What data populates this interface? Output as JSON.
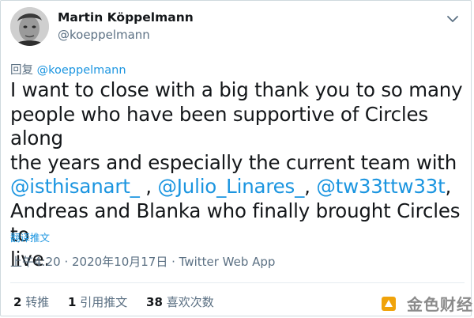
{
  "author": {
    "display_name": "Martin Köppelmann",
    "handle": "@koeppelmann"
  },
  "reply": {
    "prefix": "回复",
    "mention": "@koeppelmann"
  },
  "tweet": {
    "line1": "I want to close with a big thank you to so many",
    "line2": "people who have been supportive of Circles along",
    "line3": "the years and especially the current team with",
    "mention1": "@isthisanart_",
    "sep1": " , ",
    "mention2": "@Julio_Linares_",
    "sep2": ", ",
    "mention3": "@tw33ttw33t",
    "sep3": ",",
    "line5": "Andreas and Blanka who finally brought Circles to",
    "line6": "live."
  },
  "translate_label": "翻译推文",
  "meta": "上午4:20 · 2020年10月17日 · Twitter Web App",
  "stats": {
    "retweets_count": "2",
    "retweets_label": "转推",
    "quotes_count": "1",
    "quotes_label": "引用推文",
    "likes_count": "38",
    "likes_label": "喜欢次数"
  },
  "watermark": {
    "text": "金色财经",
    "color": "#f0a30a"
  },
  "icons": {
    "more": "chevron-down-icon",
    "logo": "watermark-logo-icon"
  },
  "colors": {
    "link": "#1b95e0",
    "secondary_text": "#5b7083",
    "primary_text": "#14171a"
  }
}
